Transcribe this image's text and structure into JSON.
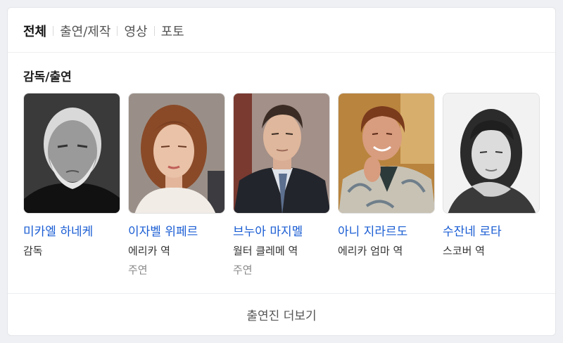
{
  "tabs": [
    {
      "label": "전체",
      "active": true
    },
    {
      "label": "출연/제작",
      "active": false
    },
    {
      "label": "영상",
      "active": false
    },
    {
      "label": "포토",
      "active": false
    }
  ],
  "section_title": "감독/출연",
  "people": [
    {
      "name": "미카엘 하네케",
      "role": "감독",
      "type": ""
    },
    {
      "name": "이자벨 위페르",
      "role": "에리카 역",
      "type": "주연"
    },
    {
      "name": "브누아 마지멜",
      "role": "월터 클레메 역",
      "type": "주연"
    },
    {
      "name": "아니 지라르도",
      "role": "에리카 엄마 역",
      "type": ""
    },
    {
      "name": "수잔네 로타",
      "role": "스코버 역",
      "type": ""
    }
  ],
  "more_label": "출연진 더보기",
  "colors": {
    "link": "#1a5dd3",
    "text": "#222222",
    "muted": "#888888"
  }
}
